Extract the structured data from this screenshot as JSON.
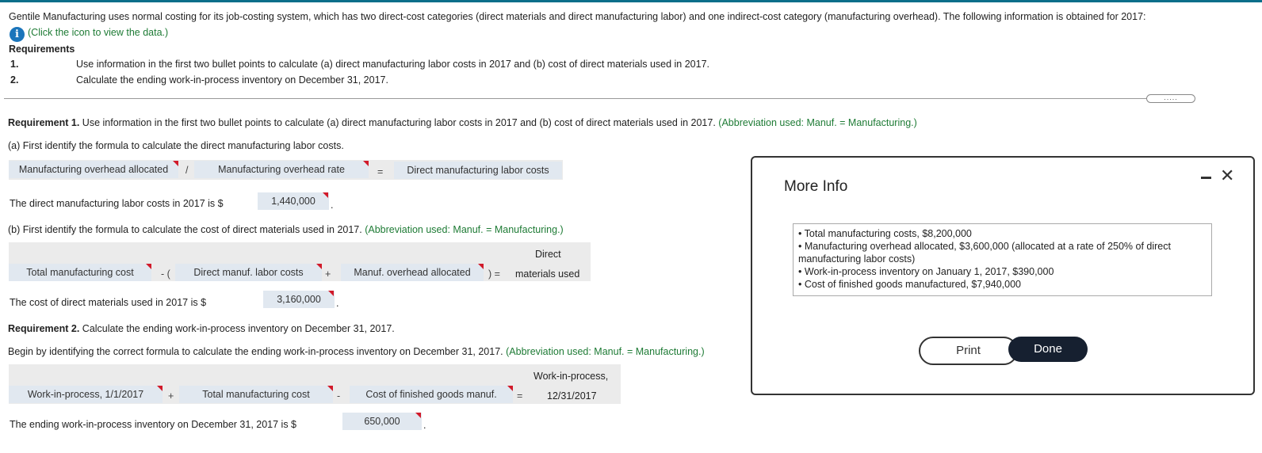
{
  "intro": {
    "text": "Gentile Manufacturing uses normal costing for its job-costing system, which has two direct-cost categories (direct materials and direct manufacturing labor) and one indirect-cost category (manufacturing overhead). The following information is obtained for 2017:",
    "data_link": "(Click the icon to view the data.)"
  },
  "requirements": {
    "heading": "Requirements",
    "items": [
      {
        "num": "1.",
        "text": "Use information in the first two bullet points to calculate (a) direct manufacturing labor costs in 2017 and (b) cost of direct materials used in 2017."
      },
      {
        "num": "2.",
        "text": "Calculate the ending work-in-process inventory on December 31, 2017."
      }
    ]
  },
  "req1": {
    "label": "Requirement 1.",
    "text": "Use information in the first two bullet points to calculate (a) direct manufacturing labor costs in 2017 and (b) cost of direct materials used in 2017.",
    "abbrev": "(Abbreviation used: Manuf. = Manufacturing.)",
    "part_a": {
      "prompt": "(a) First identify the formula to calculate the direct manufacturing labor costs.",
      "formula": {
        "term1": "Manufacturing overhead allocated",
        "op1": "/",
        "term2": "Manufacturing overhead rate",
        "eq": "=",
        "result": "Direct manufacturing labor costs"
      },
      "answer_label": "The direct manufacturing labor costs in 2017 is $",
      "answer_value": "1,440,000"
    },
    "part_b": {
      "prompt": "(b) First identify the formula to calculate the cost of direct materials used in 2017.",
      "abbrev": "(Abbreviation used: Manuf. = Manufacturing.)",
      "formula": {
        "term1": "Total manufacturing cost",
        "op1": "- (",
        "term2": "Direct manuf. labor costs",
        "op2": "+",
        "term3": "Manuf. overhead allocated",
        "eq": ") =",
        "result_line1": "Direct",
        "result_line2": "materials used"
      },
      "answer_label": "The cost of direct materials used in 2017 is $",
      "answer_value": "3,160,000"
    }
  },
  "req2": {
    "label": "Requirement 2.",
    "text": "Calculate the ending work-in-process inventory on December 31, 2017.",
    "prompt": "Begin by identifying the correct formula to calculate the ending work-in-process inventory on December 31, 2017.",
    "abbrev": "(Abbreviation used: Manuf. = Manufacturing.)",
    "formula": {
      "term1": "Work-in-process, 1/1/2017",
      "op1": "+",
      "term2": "Total manufacturing cost",
      "op2": "-",
      "term3": "Cost of finished goods manuf.",
      "eq": "=",
      "result_line1": "Work-in-process,",
      "result_line2": "12/31/2017"
    },
    "answer_label": "The ending work-in-process inventory on December 31, 2017 is $",
    "answer_value": "650,000"
  },
  "modal": {
    "title": "More Info",
    "bullet": "•",
    "lines": [
      "Total manufacturing costs, $8,200,000",
      "Manufacturing overhead allocated, $3,600,000 (allocated at a rate of 250% of direct",
      "manufacturing labor costs)",
      "Work-in-process inventory on January 1, 2017, $390,000",
      "Cost of finished goods manufactured, $7,940,000"
    ],
    "print_label": "Print",
    "done_label": "Done",
    "close_glyph": "✕",
    "expand_glyph": "....."
  },
  "colors": {
    "accent_green": "#1e7b35",
    "info_blue": "#1b75bb",
    "input_bg": "#e1e8f0",
    "marker_red": "#d11a2a",
    "done_bg": "#162030"
  }
}
